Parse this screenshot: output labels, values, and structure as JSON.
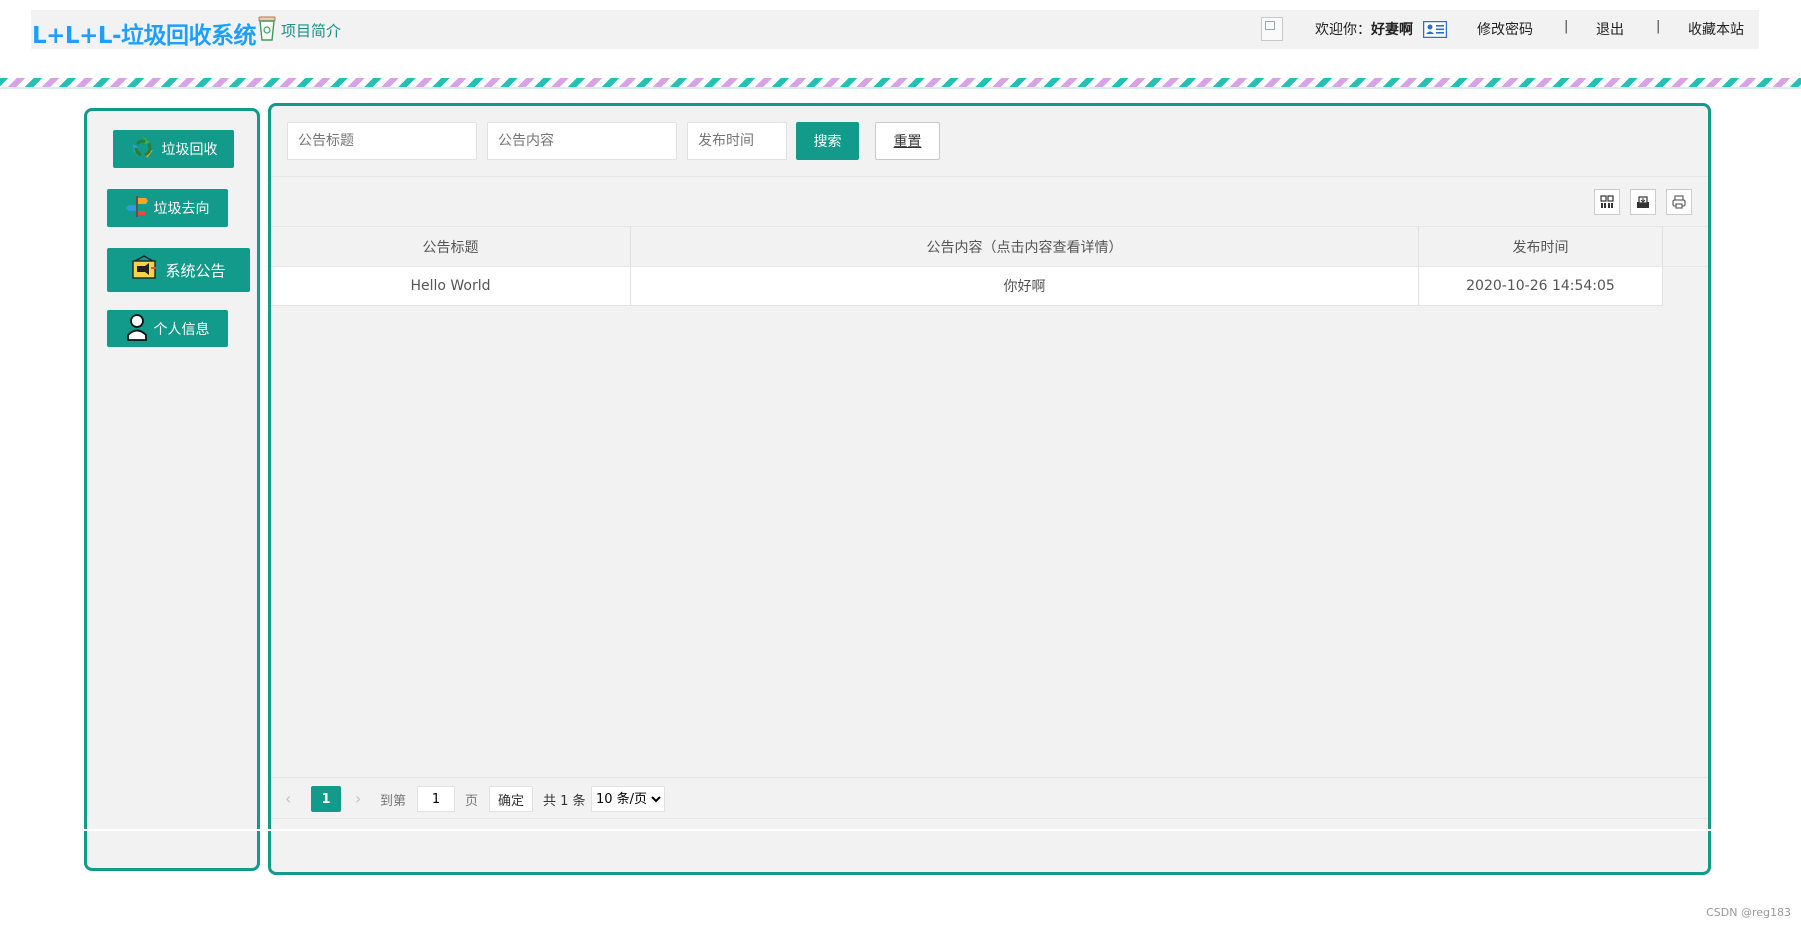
{
  "header": {
    "app_title": "L+L+L-垃圾回收系统",
    "intro_label": "项目简介",
    "welcome_prefix": "欢迎你：",
    "username": "好妻啊",
    "links": {
      "change_password": "修改密码",
      "logout": "退出",
      "bookmark": "收藏本站",
      "separator": "|"
    }
  },
  "sidebar": {
    "items": [
      {
        "label": "垃圾回收",
        "icon": "recycle-icon"
      },
      {
        "label": "垃圾去向",
        "icon": "signpost-icon"
      },
      {
        "label": "系统公告",
        "icon": "announcement-icon"
      },
      {
        "label": "个人信息",
        "icon": "person-icon"
      }
    ]
  },
  "search": {
    "title_placeholder": "公告标题",
    "content_placeholder": "公告内容",
    "time_placeholder": "发布时间",
    "search_label": "搜索",
    "reset_label": "重置"
  },
  "toolbar": {
    "icons": [
      "columns-icon",
      "export-icon",
      "print-icon"
    ]
  },
  "table": {
    "columns": [
      "公告标题",
      "公告内容（点击内容查看详情）",
      "发布时间"
    ],
    "rows": [
      [
        "Hello World",
        "你好啊",
        "2020-10-26 14:54:05"
      ]
    ]
  },
  "pager": {
    "current_page": "1",
    "goto_label": "到第",
    "page_input_value": "1",
    "page_unit": "页",
    "confirm_label": "确定",
    "total_text": "共 1 条",
    "page_size_selected": "10 条/页",
    "prev_arrow": "‹",
    "next_arrow": "›"
  },
  "watermark": "CSDN @reg183",
  "colors": {
    "accent": "#129a8a",
    "title_blue": "#1e9fff",
    "panel_bg": "#f2f2f2"
  }
}
